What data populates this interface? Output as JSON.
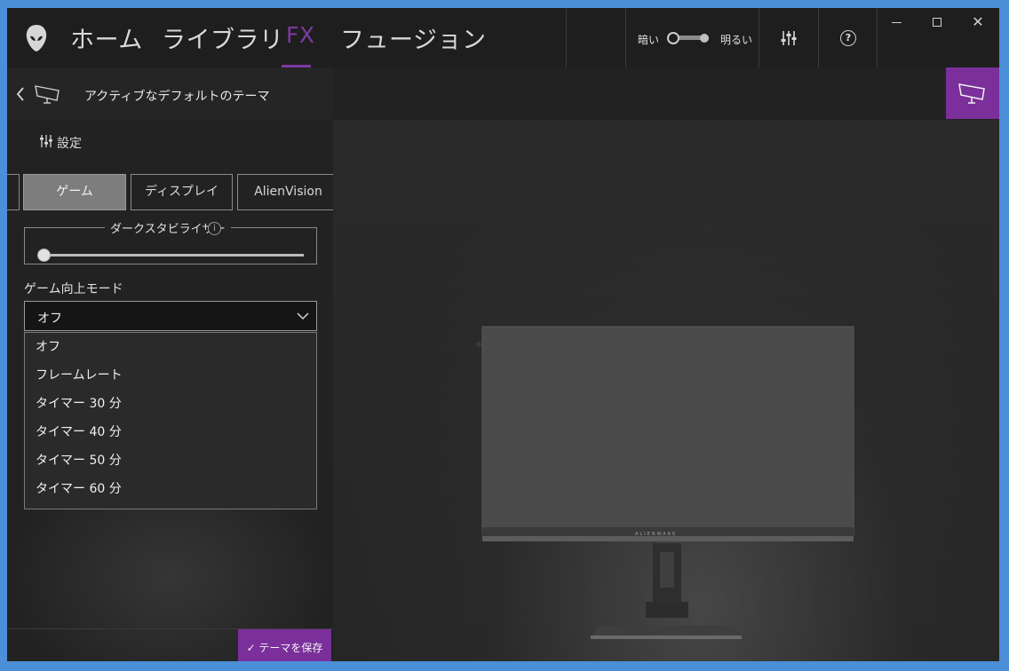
{
  "header": {
    "nav": {
      "home": "ホーム",
      "library": "ライブラリ",
      "fx": "FX",
      "fusion": "フュージョン"
    },
    "brightness": {
      "dark_label": "暗い",
      "bright_label": "明るい"
    },
    "help_glyph": "?",
    "window_close": "✕"
  },
  "left": {
    "theme_title": "アクティブなデフォルトのテーマ",
    "settings_label": "設定",
    "tabs": {
      "game": "ゲーム",
      "display": "ディスプレイ",
      "alienvision": "AlienVision"
    },
    "dark_stabilizer": {
      "label": "ダークスタビライザー",
      "info_glyph": "i"
    },
    "game_enhance": {
      "label": "ゲーム向上モード",
      "selected": "オフ",
      "options": [
        "オフ",
        "フレームレート",
        "タイマー 30 分",
        "タイマー 40 分",
        "タイマー 50 分",
        "タイマー 60 分"
      ]
    },
    "save_button": "✓ テーマを保存"
  },
  "preview": {
    "brand": "ALIENWARE"
  },
  "colors": {
    "accent": "#7a2f9b",
    "fx_active": "#7c3aa0",
    "window_frame": "#4a8fd8"
  }
}
